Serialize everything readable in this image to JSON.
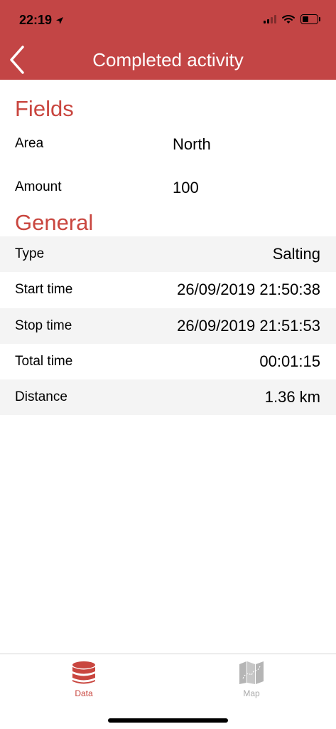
{
  "status_bar": {
    "time": "22:19"
  },
  "nav": {
    "title": "Completed activity"
  },
  "fields": {
    "heading": "Fields",
    "items": [
      {
        "label": "Area",
        "value": "North"
      },
      {
        "label": "Amount",
        "value": "100"
      }
    ]
  },
  "general": {
    "heading": "General",
    "rows": [
      {
        "label": "Type",
        "value": "Salting"
      },
      {
        "label": "Start time",
        "value": "26/09/2019 21:50:38"
      },
      {
        "label": "Stop time",
        "value": "26/09/2019 21:51:53"
      },
      {
        "label": "Total time",
        "value": "00:01:15"
      },
      {
        "label": "Distance",
        "value": "1.36 km"
      }
    ]
  },
  "tabbar": {
    "tabs": [
      {
        "label": "Data",
        "icon": "database-icon",
        "active": true
      },
      {
        "label": "Map",
        "icon": "map-icon",
        "active": false
      }
    ]
  },
  "colors": {
    "header": "#c34545",
    "accent": "#c9463f",
    "row_shade": "#f4f4f4",
    "inactive": "#a9a9a9"
  }
}
